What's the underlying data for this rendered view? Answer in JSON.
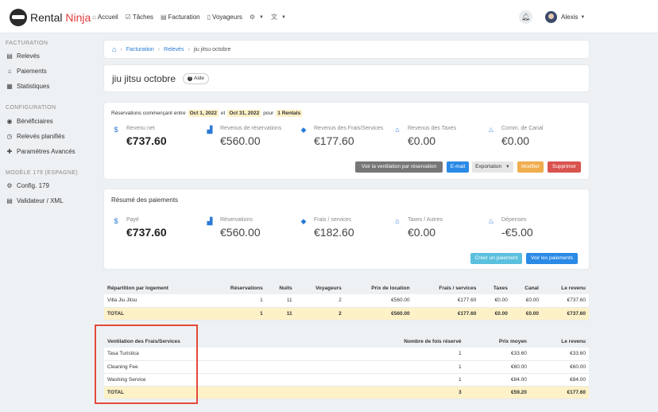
{
  "app": {
    "brand_a": "Rental",
    "brand_b": "Ninja"
  },
  "nav": {
    "items": [
      {
        "icon": "home-icon",
        "glyph": "⌂",
        "label": "Accueil"
      },
      {
        "icon": "tasks-icon",
        "glyph": "☑",
        "label": "Tâches"
      },
      {
        "icon": "invoice-icon",
        "glyph": "▤",
        "label": "Facturation"
      },
      {
        "icon": "travelers-icon",
        "glyph": "▯",
        "label": "Voyageurs"
      }
    ],
    "user": "Alexis"
  },
  "sidebar": {
    "sections": [
      {
        "title": "FACTURATION",
        "items": [
          {
            "icon": "statements-icon",
            "glyph": "▤",
            "label": "Relevés"
          },
          {
            "icon": "payments-icon",
            "glyph": "⌂",
            "label": "Paiements"
          },
          {
            "icon": "stats-icon",
            "glyph": "▦",
            "label": "Statistiques"
          }
        ]
      },
      {
        "title": "CONFIGURATION",
        "items": [
          {
            "icon": "beneficiaries-icon",
            "glyph": "◉",
            "label": "Bénéficiaires"
          },
          {
            "icon": "scheduled-icon",
            "glyph": "◷",
            "label": "Relevés planifiés"
          },
          {
            "icon": "puzzle-icon",
            "glyph": "✚",
            "label": "Paramètres Avancés"
          }
        ]
      },
      {
        "title": "MODÈLE 179 (ESPAGNE)",
        "items": [
          {
            "icon": "gear-icon",
            "glyph": "⚙",
            "label": "Config. 179"
          },
          {
            "icon": "validator-icon",
            "glyph": "▤",
            "label": "Validateur / XML"
          }
        ]
      }
    ]
  },
  "breadcrumb": {
    "items": [
      "Facturation",
      "Relevés"
    ],
    "current": "jiu jitsu octobre"
  },
  "page": {
    "title": "jiu jitsu octobre",
    "help": "Aide"
  },
  "summary": {
    "period_prefix": "Réservations commençant entre",
    "date_from": "Oct 1, 2022",
    "and": "et",
    "date_to": "Oct 31, 2022",
    "for": "pour",
    "rentals": "1 Rentals",
    "stats": [
      {
        "icon": "dollar-icon",
        "glyph": "$",
        "color": "#2a7ad6",
        "label": "Revenu net",
        "value": "€737.60",
        "bold": true
      },
      {
        "icon": "building-icon",
        "glyph": "▟",
        "color": "#2a7ad6",
        "label": "Revenus de réservations",
        "value": "€560.00"
      },
      {
        "icon": "tag-icon",
        "glyph": "◆",
        "color": "#2a7ad6",
        "label": "Revenus des Frais/Services",
        "value": "€177.60"
      },
      {
        "icon": "bank-icon",
        "glyph": "⌂",
        "color": "#2a7ad6",
        "label": "Revenus des Taxes",
        "value": "€0.00"
      },
      {
        "icon": "fire-icon",
        "glyph": "♨",
        "color": "#2a7ad6",
        "label": "Comm. de Canal",
        "value": "€0.00"
      }
    ],
    "buttons": {
      "breakdown": "Voir la ventilation par réservation",
      "email": "E-mail",
      "export": "Exportation",
      "edit": "Modifier",
      "delete": "Supprimer"
    }
  },
  "payments": {
    "title": "Résumé des paiements",
    "stats": [
      {
        "icon": "dollar-icon",
        "glyph": "$",
        "label": "Payé",
        "value": "€737.60",
        "bold": true
      },
      {
        "icon": "building-icon",
        "glyph": "▟",
        "label": "Réservations",
        "value": "€560.00"
      },
      {
        "icon": "tag-icon",
        "glyph": "◆",
        "label": "Frais / services",
        "value": "€182.60"
      },
      {
        "icon": "bank-icon",
        "glyph": "⌂",
        "label": "Taxes / Autres",
        "value": "€0.00"
      },
      {
        "icon": "fire-icon",
        "glyph": "♨",
        "label": "Dépenses",
        "value": "-€5.00"
      }
    ],
    "buttons": {
      "create": "Créer un paiement",
      "view": "Voir les paiements"
    }
  },
  "lodging_table": {
    "headers": [
      "Répartition par logement",
      "Réservations",
      "Nuits",
      "Voyageurs",
      "Prix de location",
      "Frais / services",
      "Taxes",
      "Canal",
      "Le revenu"
    ],
    "rows": [
      [
        "Villa Jiu Jitsu",
        "1",
        "11",
        "2",
        "€560.00",
        "€177.60",
        "€0.00",
        "€0.00",
        "€737.60"
      ]
    ],
    "total": [
      "TOTAL",
      "1",
      "11",
      "2",
      "€560.00",
      "€177.60",
      "€0.00",
      "€0.00",
      "€737.60"
    ]
  },
  "fees_table": {
    "headers": [
      "Ventilation des Frais/Services",
      "Nombre de fois réservé",
      "Prix moyen",
      "Le revenu"
    ],
    "rows": [
      [
        "Tasa Turistica",
        "1",
        "€33.60",
        "€33.60"
      ],
      [
        "Cleaning Fee",
        "1",
        "€60.00",
        "€60.00"
      ],
      [
        "Washing Service",
        "1",
        "€84.00",
        "€84.00"
      ]
    ],
    "total": [
      "TOTAL",
      "3",
      "€59.20",
      "€177.60"
    ]
  },
  "colors": {
    "primary": "#2a7ad6",
    "info": "#5bc0de",
    "warning": "#f0ad4e",
    "danger": "#d9534f",
    "grey": "#777777",
    "highlight": "#fdf1c7",
    "annotation": "#e24a3b"
  }
}
